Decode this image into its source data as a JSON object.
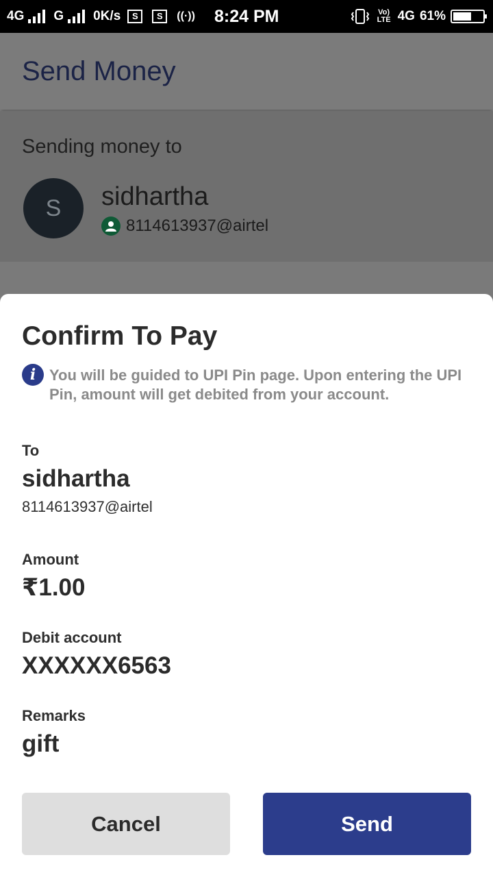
{
  "status_bar": {
    "net1": "4G",
    "net2": "G",
    "speed": "0K/s",
    "sim_label": "S",
    "hotspot": "((·))",
    "time": "8:24 PM",
    "volte": "Vo) LTE",
    "net3": "4G",
    "battery": "61%",
    "battery_level": 0.61
  },
  "app": {
    "title": "Send Money",
    "sending_to_caption": "Sending money to",
    "avatar_letter": "S",
    "recipient_name": "sidhartha",
    "recipient_vpa": "8114613937@airtel"
  },
  "sheet": {
    "heading": "Confirm To Pay",
    "info_glyph": "i",
    "info_text": "You will be guided to UPI Pin page. Upon entering the UPI Pin, amount will get debited from your account.",
    "to_label": "To",
    "to_name": "sidhartha",
    "to_vpa": "8114613937@airtel",
    "amount_label": "Amount",
    "amount_value": "₹1.00",
    "debit_label": "Debit account",
    "debit_value": "XXXXXX6563",
    "remarks_label": "Remarks",
    "remarks_value": "gift",
    "cancel_label": "Cancel",
    "send_label": "Send"
  },
  "colors": {
    "primary": "#2c3d8c",
    "vpa_badge": "#0f5a36"
  },
  "icons": [
    "signal-icon",
    "sim-icon",
    "hotspot-icon",
    "vibrate-icon",
    "battery-icon",
    "info-icon",
    "user-badge-icon"
  ]
}
